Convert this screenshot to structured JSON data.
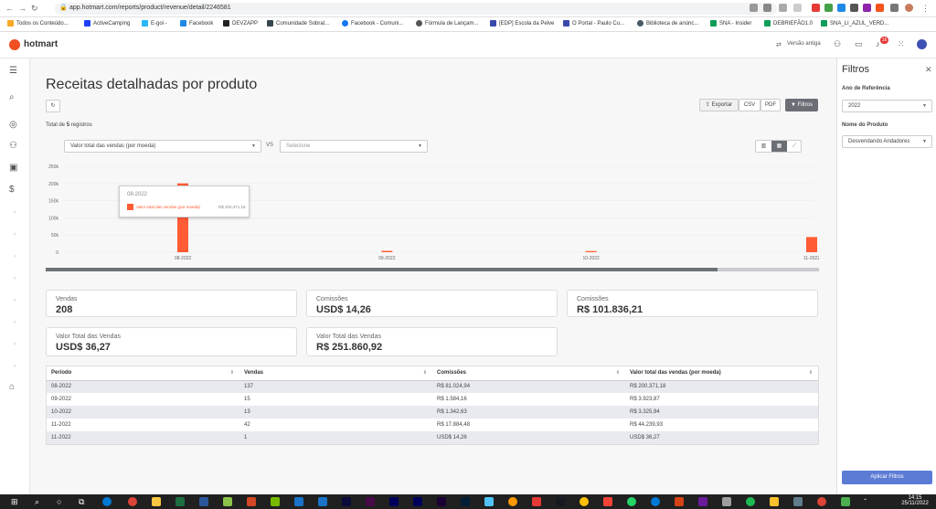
{
  "browser": {
    "url": "app.hotmart.com/reports/product/revenue/detail/2246581",
    "bookmarks": [
      "Todos os Conteúdo...",
      "ActiveCamping",
      "E-goi -",
      "Facebook",
      "DEVZAPP",
      "Comunidade Sobral...",
      "Facebook - Comuni...",
      "Fórmula de Lançam...",
      "[EDP] Escola da Pelve",
      "O Portal - Paulo Cu...",
      "Biblioteca de anúnc...",
      "SNA - Insider",
      "DEBRIEFÃO1.0",
      "SNA_LI_AZUL_VERD..."
    ]
  },
  "header": {
    "logo": "hotmart",
    "old_version": "Versão antiga",
    "notification_count": "16"
  },
  "page": {
    "title": "Receitas detalhadas por produto",
    "total_prefix": "Total de ",
    "total_count": "5",
    "total_suffix": " registros",
    "export_label": "Exportar",
    "csv_label": "CSV",
    "pdf_label": "PDF",
    "filters_label": "Filtros",
    "metric_select": "Valor total das vendas (por moeda)",
    "vs_label": "VS",
    "compare_placeholder": "Selecione"
  },
  "chart_data": {
    "type": "bar",
    "categories": [
      "08-2022",
      "09-2022",
      "10-2022",
      "11-2022"
    ],
    "series": [
      {
        "name": "Valor total das vendas (por moeda)",
        "values": [
          200371.18,
          3923.87,
          3325.94,
          44239.93
        ]
      }
    ],
    "ylim": [
      0,
      250000
    ],
    "yticks": [
      "250k",
      "200k",
      "150k",
      "100k",
      "50k",
      "0"
    ],
    "ytick_values": [
      250000,
      200000,
      150000,
      100000,
      50000,
      0
    ],
    "tooltip": {
      "title": "08-2022",
      "series": "Valor total das vendas (por moeda)",
      "value": "R$ 200.371,18"
    },
    "color": "#ff5c35"
  },
  "cards": [
    {
      "label": "Vendas",
      "value": "208"
    },
    {
      "label": "Comissões",
      "value": "USD$ 14,26"
    },
    {
      "label": "Comissões",
      "value": "R$ 101.836,21"
    },
    {
      "label": "Valor Total das Vendas",
      "value": "USD$ 36,27"
    },
    {
      "label": "Valor Total das Vendas",
      "value": "R$ 251.860,92"
    }
  ],
  "table": {
    "headers": [
      "Período",
      "Vendas",
      "Comissões",
      "Valor total das vendas (por moeda)"
    ],
    "rows": [
      [
        "08-2022",
        "137",
        "R$ 81.024,94",
        "R$ 200.371,18"
      ],
      [
        "09-2022",
        "15",
        "R$ 1.584,16",
        "R$ 3.923,87"
      ],
      [
        "10-2022",
        "13",
        "R$ 1.342,63",
        "R$ 3.325,94"
      ],
      [
        "11-2022",
        "42",
        "R$ 17.884,48",
        "R$ 44.239,93"
      ],
      [
        "11-2022",
        "1",
        "USD$ 14,26",
        "USD$ 36,27"
      ]
    ]
  },
  "filters": {
    "title": "Filtros",
    "year_label": "Ano de Referência",
    "year_value": "2022",
    "product_label": "Nome do Produto",
    "product_value": "Desvendando Andadores",
    "apply_label": "Aplicar Filtros"
  },
  "taskbar": {
    "time": "14:15",
    "date": "25/11/2022"
  }
}
